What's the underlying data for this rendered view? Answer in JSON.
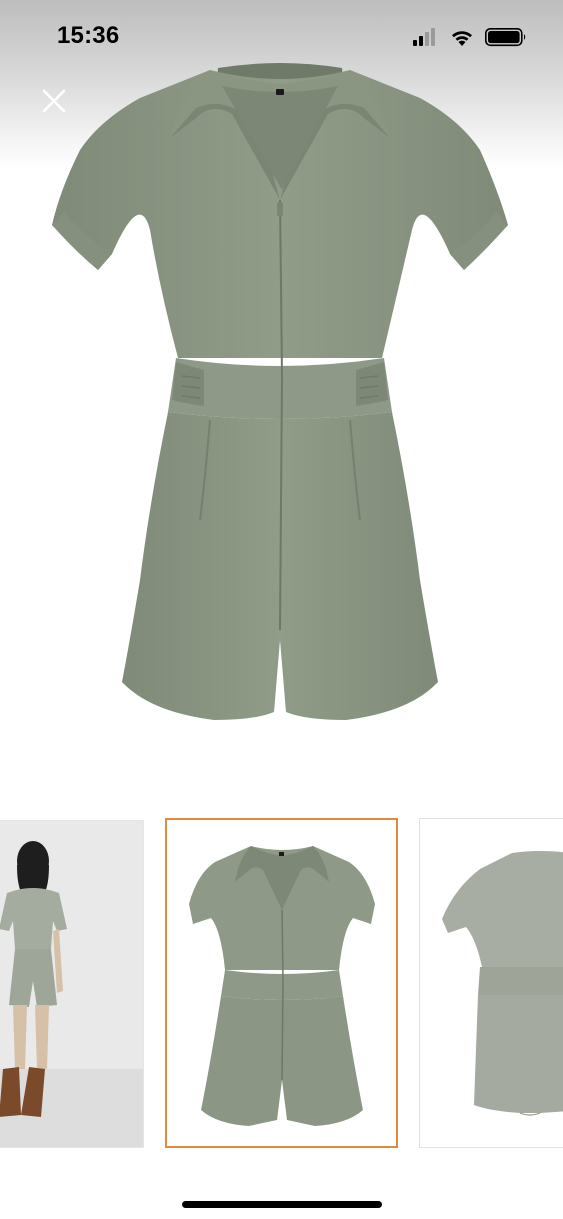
{
  "status_bar": {
    "time": "15:36",
    "signal_icon": "cellular-signal-icon",
    "wifi_icon": "wifi-icon",
    "battery_icon": "battery-icon"
  },
  "viewer": {
    "close_icon": "close-icon",
    "main_image": "olive-green-short-sleeve-romper-product-photo",
    "selected_thumbnail_index": 1,
    "accent_color": "#e28a3f",
    "garment_color": "#8e9a86"
  },
  "thumbnails": [
    {
      "image": "model-wearing-romper-back-view"
    },
    {
      "image": "romper-front-view"
    },
    {
      "image": "romper-back-view"
    }
  ]
}
